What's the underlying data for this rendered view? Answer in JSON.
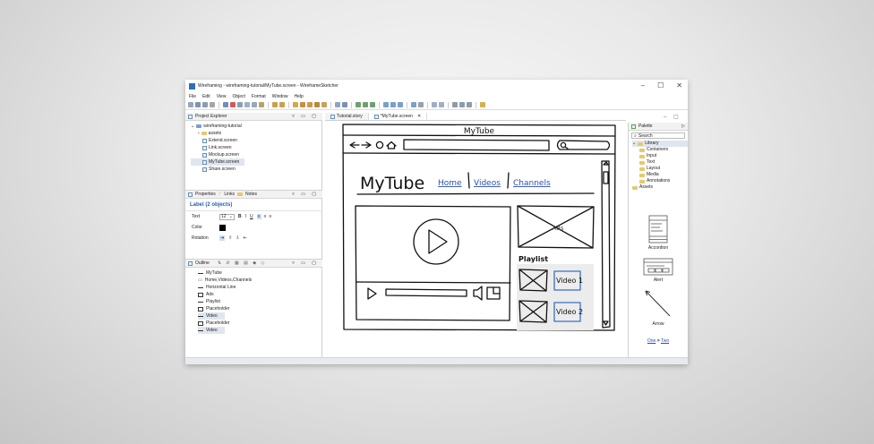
{
  "window": {
    "title": "Wireframing - wireframing-tutorial/MyTube.screen - WireframeSketcher",
    "controls": [
      "–",
      "☐",
      "✕"
    ]
  },
  "menu": [
    "File",
    "Edit",
    "View",
    "Object",
    "Format",
    "Window",
    "Help"
  ],
  "project_explorer": {
    "title": "Project Explorer",
    "root": "wireframing-tutorial",
    "folder": "assets",
    "files": [
      "Extend.screen",
      "Link.screen",
      "Mockup.screen",
      "MyTube.screen",
      "Share.screen"
    ]
  },
  "properties": {
    "tabs": [
      "Properties",
      "Links",
      "Notes"
    ],
    "title": "Label (2 objects)",
    "text_label": "Text",
    "font_size": "12",
    "color_label": "Color",
    "rotation_label": "Rotation"
  },
  "outline": {
    "title": "Outline",
    "items": [
      {
        "icon": "dash",
        "label": "MyTube"
      },
      {
        "icon": "link",
        "label": "Home,Videos,Channels"
      },
      {
        "icon": "dash",
        "label": "Horizontal Line"
      },
      {
        "icon": "box",
        "label": "Ads"
      },
      {
        "icon": "dash",
        "label": "Playlist"
      },
      {
        "icon": "box",
        "label": "Placeholder"
      },
      {
        "icon": "dash",
        "label": "Video"
      },
      {
        "icon": "box",
        "label": "Placeholder"
      },
      {
        "icon": "dash",
        "label": "Video"
      }
    ]
  },
  "editor": {
    "tabs": [
      "Tutorial.story",
      "*MyTube.screen"
    ],
    "mock": {
      "window_title": "MyTube",
      "logo": "MyTube",
      "nav": [
        "Home",
        "Videos",
        "Channels"
      ],
      "ads": "Ads",
      "playlist": "Playlist",
      "video1": "Video 1",
      "video2": "Video 2"
    }
  },
  "palette": {
    "title": "Palette",
    "search": "Search",
    "library": "Library",
    "categories": [
      "Containers",
      "Input",
      "Text",
      "Layout",
      "Media",
      "Annotations"
    ],
    "assets": "Assets",
    "previews": [
      "Accordion",
      "Alert",
      "Arrow"
    ],
    "link_one": "One",
    "link_two": "Two",
    "link_sep": ">"
  }
}
